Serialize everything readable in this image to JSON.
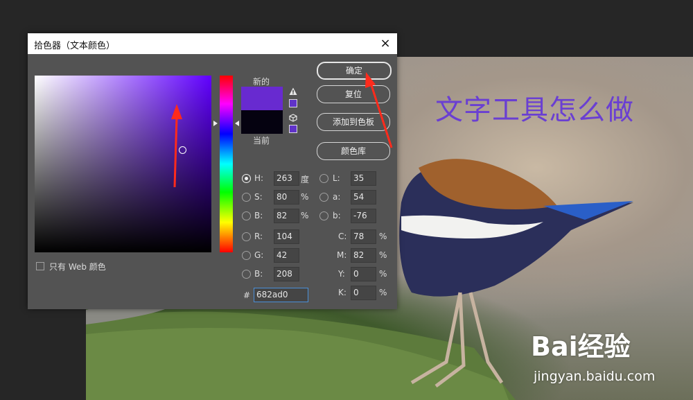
{
  "photo": {
    "overlay_title": "文字工具怎么做"
  },
  "watermark": {
    "brand": "Bai经验",
    "paw": "du",
    "url": "jingyan.baidu.com"
  },
  "dialog": {
    "title": "拾色器（文本颜色）",
    "close_icon": "×",
    "label_new": "新的",
    "label_current": "当前",
    "new_color": "#682ad0",
    "current_color": "#050210",
    "buttons": {
      "ok": "确定",
      "reset": "复位",
      "add_swatch": "添加到色板",
      "libraries": "颜色库"
    },
    "web_only": "只有 Web 颜色",
    "hsb": [
      {
        "label": "H:",
        "value": "263",
        "unit": "度",
        "selected": true
      },
      {
        "label": "S:",
        "value": "80",
        "unit": "%",
        "selected": false
      },
      {
        "label": "B:",
        "value": "82",
        "unit": "%",
        "selected": false
      }
    ],
    "rgb": [
      {
        "label": "R:",
        "value": "104"
      },
      {
        "label": "G:",
        "value": "42"
      },
      {
        "label": "B:",
        "value": "208"
      }
    ],
    "lab": [
      {
        "label": "L:",
        "value": "35"
      },
      {
        "label": "a:",
        "value": "54"
      },
      {
        "label": "b:",
        "value": "-76"
      }
    ],
    "cmyk": [
      {
        "label": "C:",
        "value": "78",
        "unit": "%"
      },
      {
        "label": "M:",
        "value": "82",
        "unit": "%"
      },
      {
        "label": "Y:",
        "value": "0",
        "unit": "%"
      },
      {
        "label": "K:",
        "value": "0",
        "unit": "%"
      }
    ],
    "hex_label": "#",
    "hex_value": "682ad0"
  },
  "annotation_color": "#ff2b1c"
}
